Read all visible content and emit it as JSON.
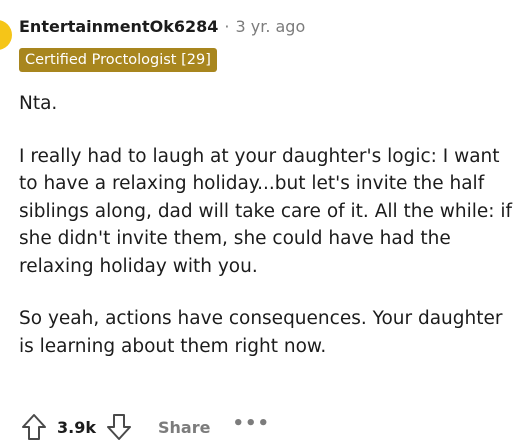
{
  "comment": {
    "author": "EntertainmentOk6284",
    "separator": "·",
    "time": "3 yr. ago",
    "flair": {
      "text": "Certified Proctologist [29]",
      "color": "#a8861e"
    },
    "avatar_color": "#f5c518",
    "paragraphs": [
      "Nta.",
      "I really had to laugh at your daughter's logic: I want to have a relaxing holiday...but let's invite the half siblings along, dad will take care of it. All the while: if she didn't invite them, she could have had the relaxing holiday with you.",
      "So yeah, actions have consequences. Your daughter is learning about them right now."
    ]
  },
  "actions": {
    "upvote_icon": "arrow-up-icon",
    "score": "3.9k",
    "downvote_icon": "arrow-down-icon",
    "share_label": "Share",
    "more_label": "•••"
  }
}
